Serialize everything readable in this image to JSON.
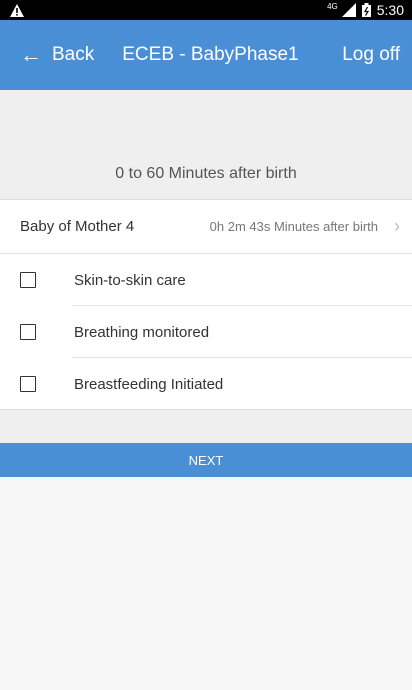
{
  "status_bar": {
    "network": "4G",
    "time": "5:30",
    "icons": [
      "alert-icon",
      "signal-icon",
      "battery-icon"
    ]
  },
  "app_bar": {
    "back_label": "Back",
    "title": "ECEB - BabyPhase1",
    "logoff_label": "Log off"
  },
  "phase": {
    "label": "0 to 60 Minutes after birth"
  },
  "baby": {
    "name": "Baby of Mother 4",
    "elapsed": "0h 2m 43s Minutes after birth"
  },
  "checklist": [
    {
      "label": "Skin-to-skin care",
      "checked": false
    },
    {
      "label": "Breathing monitored",
      "checked": false
    },
    {
      "label": "Breastfeeding Initiated",
      "checked": false
    }
  ],
  "next_label": "NEXT",
  "colors": {
    "accent": "#4a8fd6",
    "background": "#efefef"
  }
}
